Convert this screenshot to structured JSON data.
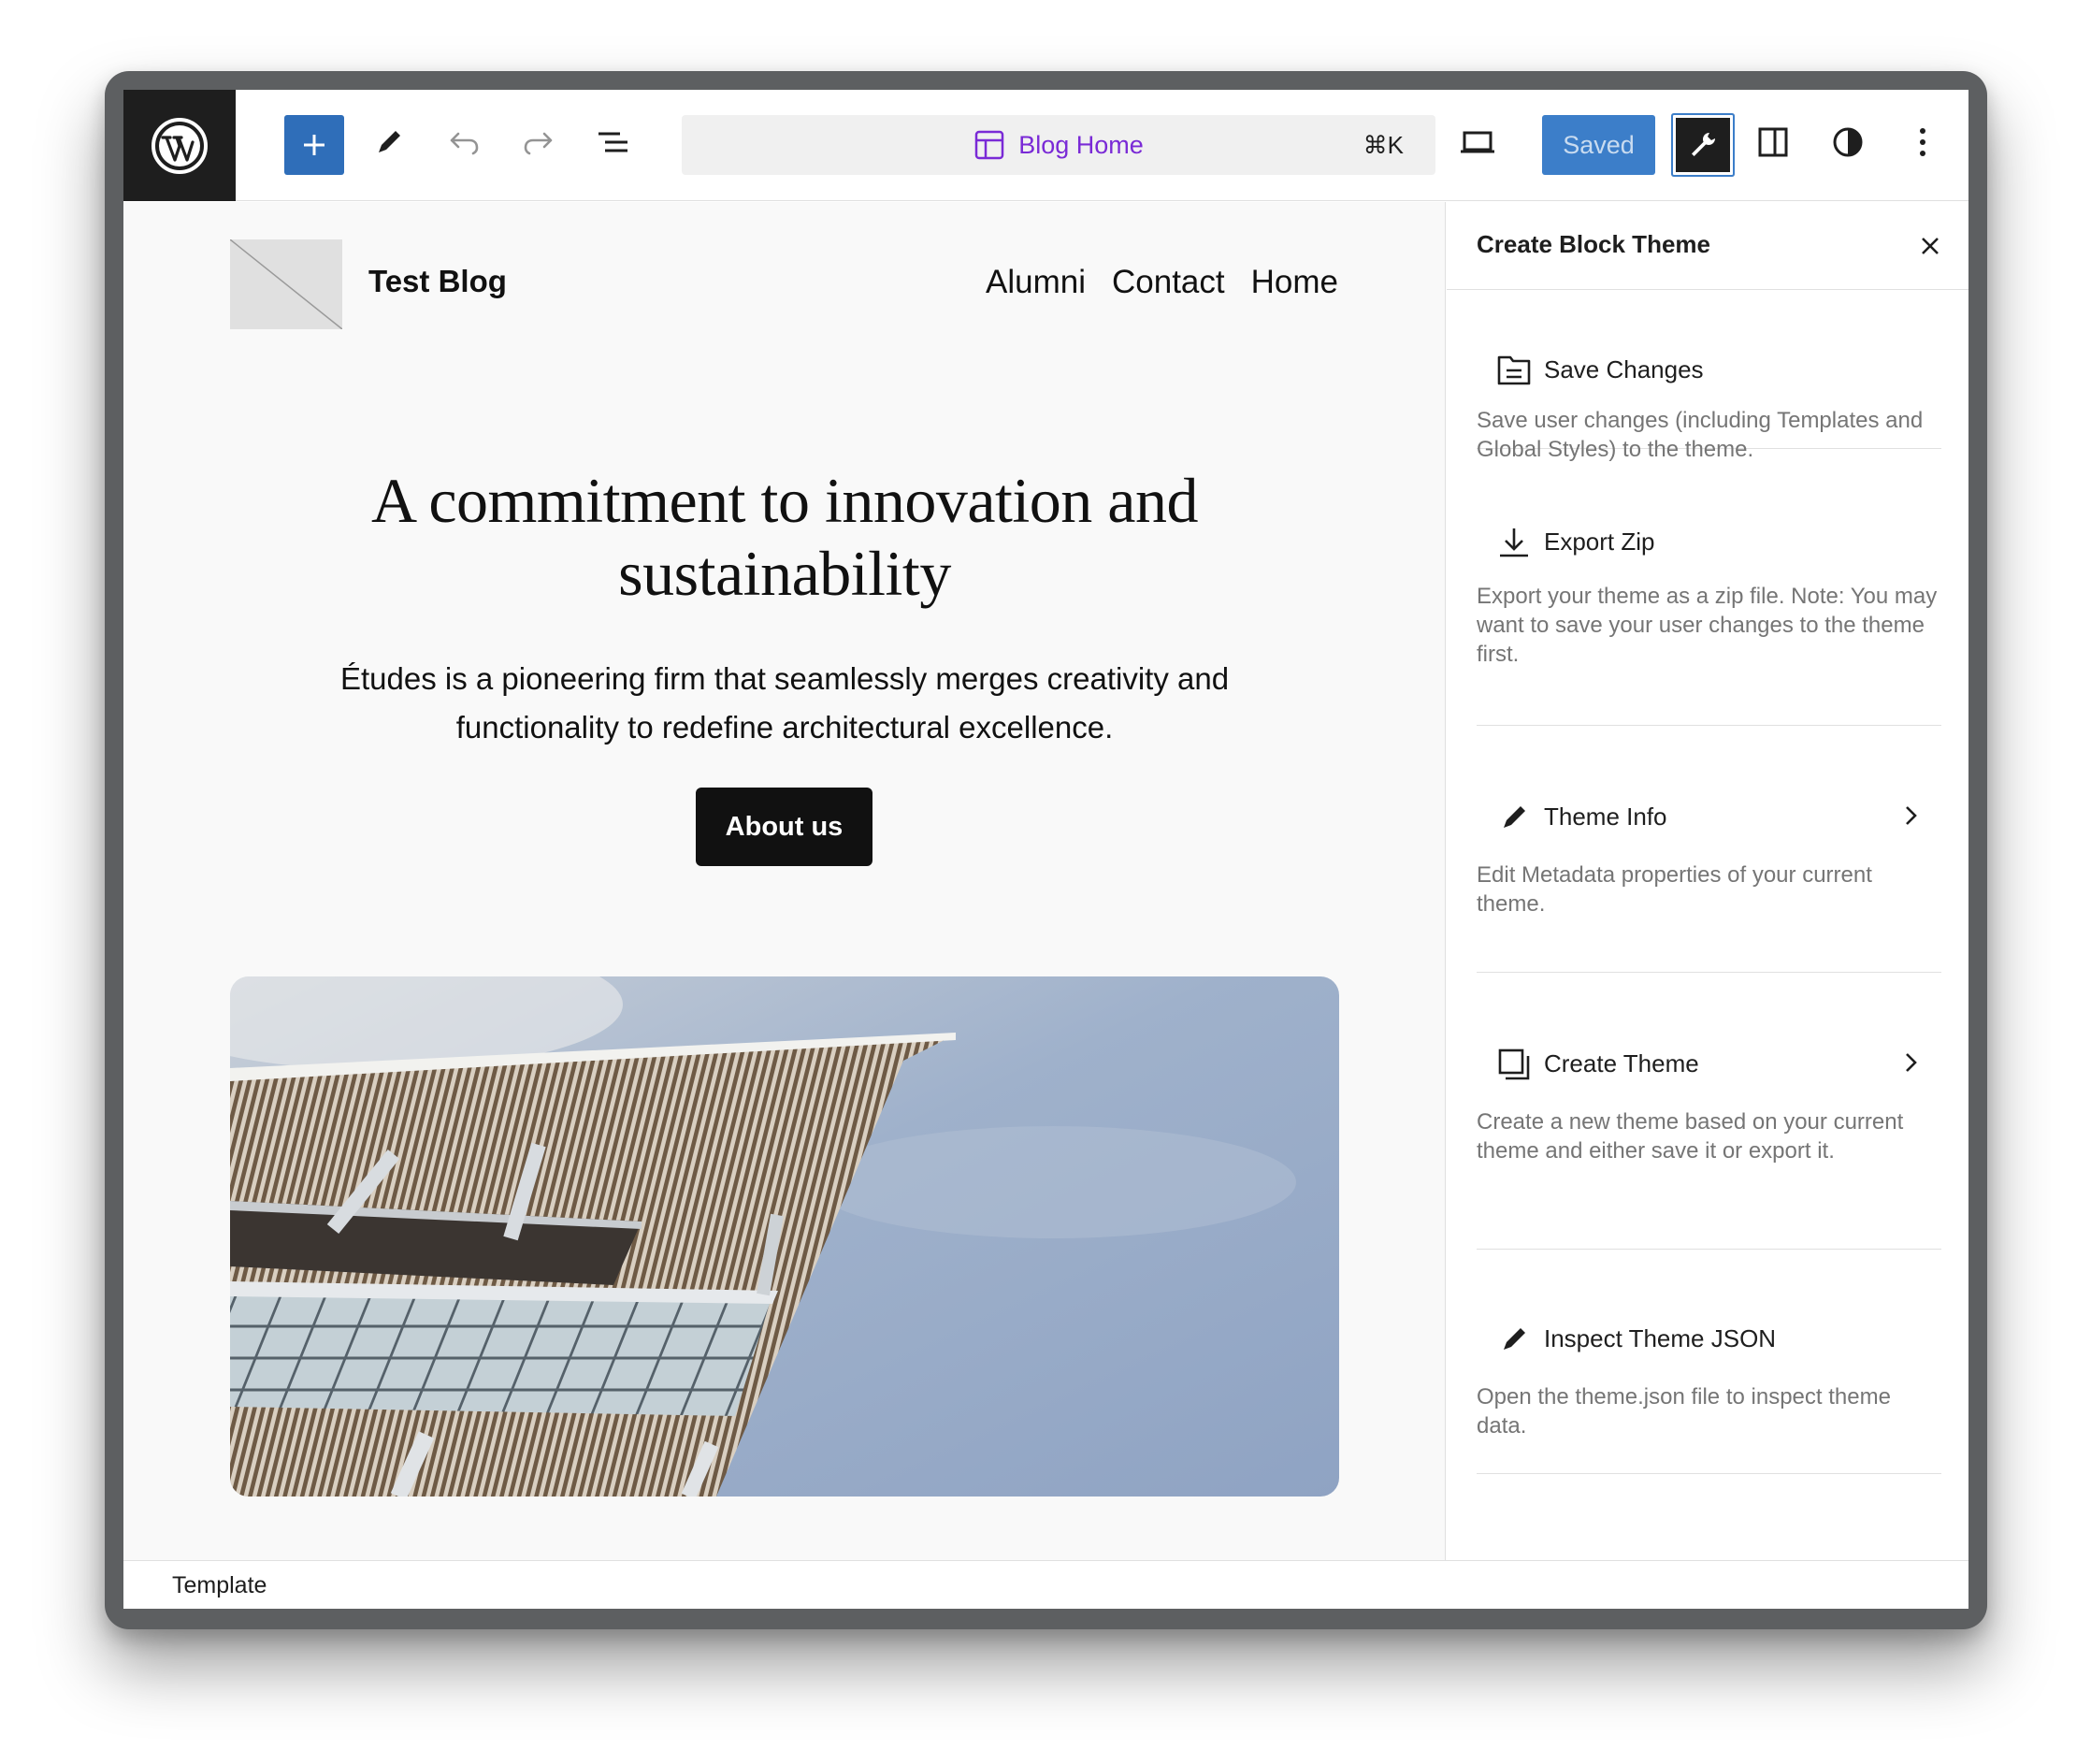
{
  "toolbar": {
    "document_title": "Blog Home",
    "shortcut": "⌘K",
    "saved_label": "Saved",
    "icons": [
      "wordpress-icon",
      "plus-icon",
      "pencil-icon",
      "undo-icon",
      "redo-icon",
      "list-view-icon",
      "template-icon",
      "desktop-icon",
      "wrench-icon",
      "sidebar-icon",
      "contrast-icon",
      "more-vertical-icon"
    ]
  },
  "canvas": {
    "site_title": "Test Blog",
    "nav": [
      "Alumni",
      "Contact",
      "Home"
    ],
    "hero_title": "A commitment to innovation and sustainability",
    "hero_text": "Études is a pioneering firm that seamlessly merges creativity and functionality to redefine architectural excellence.",
    "button_label": "About us"
  },
  "sidebar": {
    "title": "Create Block Theme",
    "items": [
      {
        "label": "Save Changes",
        "description": "Save user changes (including Templates and Global Styles) to the theme.",
        "icon": "document-icon",
        "has_chevron": false
      },
      {
        "label": "Export Zip",
        "description": "Export your theme as a zip file. Note: You may want to save your user changes to the theme first.",
        "icon": "download-icon",
        "has_chevron": false
      },
      {
        "label": "Theme Info",
        "description": "Edit Metadata properties of your current theme.",
        "icon": "pencil-icon",
        "has_chevron": true
      },
      {
        "label": "Create Theme",
        "description": "Create a new theme based on your current theme and either save it or export it.",
        "icon": "copy-icon",
        "has_chevron": true
      },
      {
        "label": "Inspect Theme JSON",
        "description": "Open the theme.json file to inspect theme data.",
        "icon": "pencil-icon",
        "has_chevron": false
      }
    ]
  },
  "footer": {
    "breadcrumb": "Template"
  },
  "colors": {
    "accent": "#3858e9",
    "saved_button": "#3c7ec9",
    "command_text": "#7a2ad6",
    "dark": "#1e1e1e"
  }
}
